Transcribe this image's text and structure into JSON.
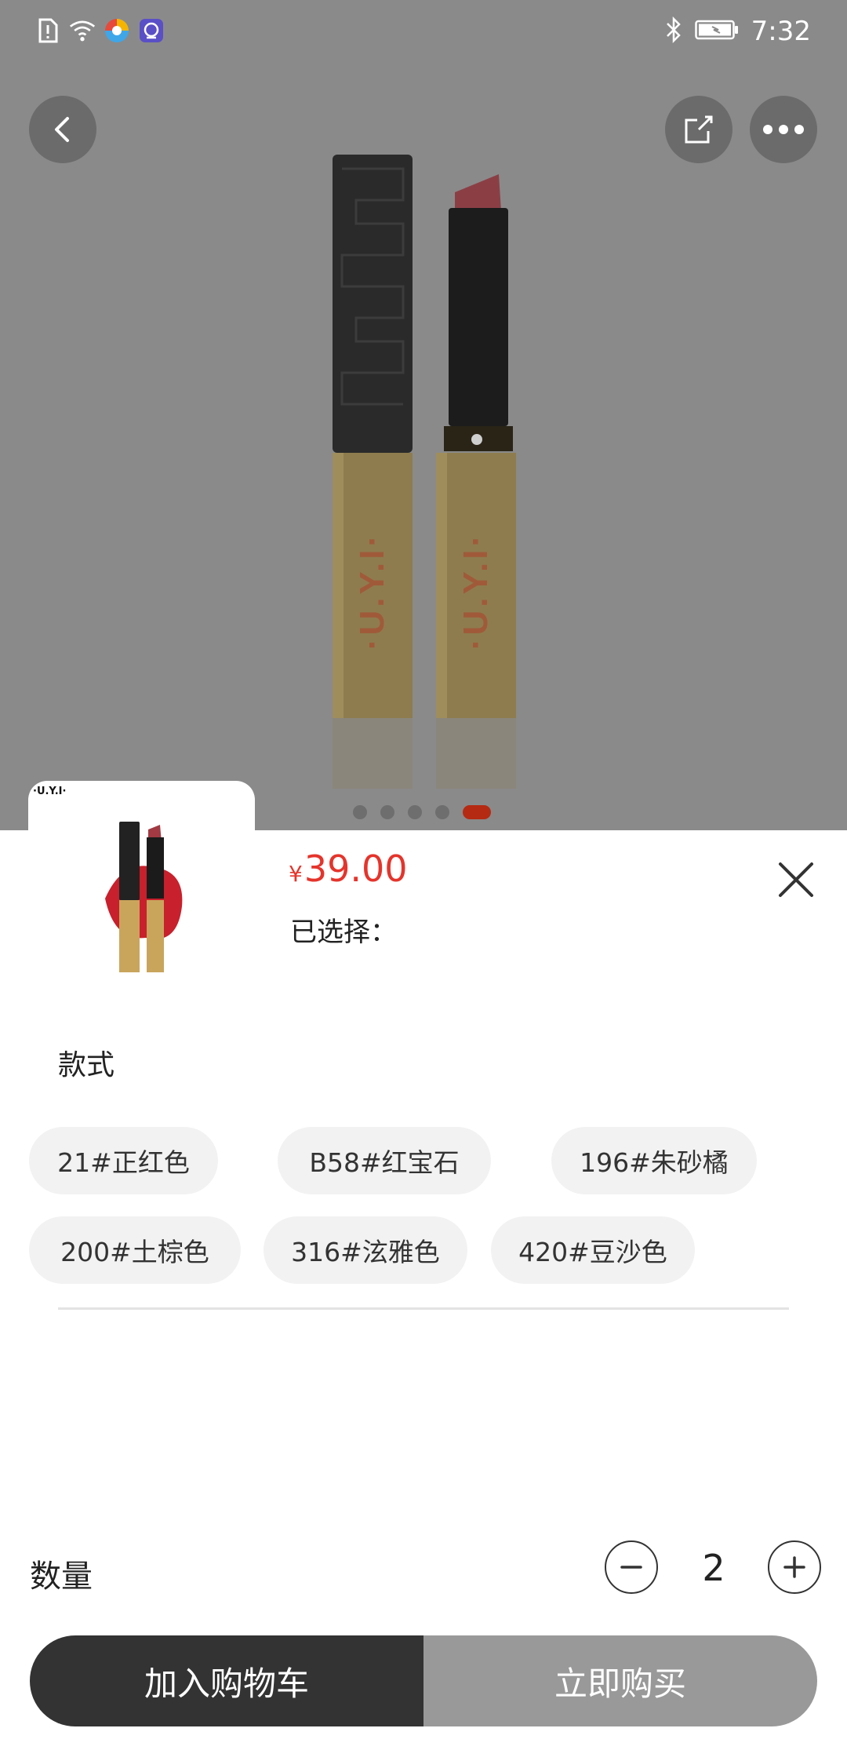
{
  "status_bar": {
    "time": "7:32",
    "left_icons": [
      "sim-alert-icon",
      "wifi-icon",
      "browser-app-icon",
      "app-notification-icon"
    ],
    "right_icons": [
      "bluetooth-icon",
      "battery-icon"
    ]
  },
  "product_images": {
    "brand_text": "·U.Y.I·",
    "carousel_count": 5,
    "carousel_active_index": 4
  },
  "sheet": {
    "price_symbol": "¥",
    "price": "39.00",
    "selected_label": "已选择：",
    "thumbnail_brand": "·U.Y.I·",
    "style_section_title": "款式",
    "options": [
      "21#正红色",
      "B58#红宝石",
      "196#朱砂橘",
      "200#土棕色",
      "316#泫雅色",
      "420#豆沙色"
    ],
    "quantity_label": "数量",
    "quantity": "2",
    "add_to_cart_label": "加入购物车",
    "buy_now_label": "立即购买"
  },
  "colors": {
    "price": "#e5342b",
    "carousel_active": "#b52a12",
    "cart_button": "#333333",
    "buy_button": "#999999"
  }
}
